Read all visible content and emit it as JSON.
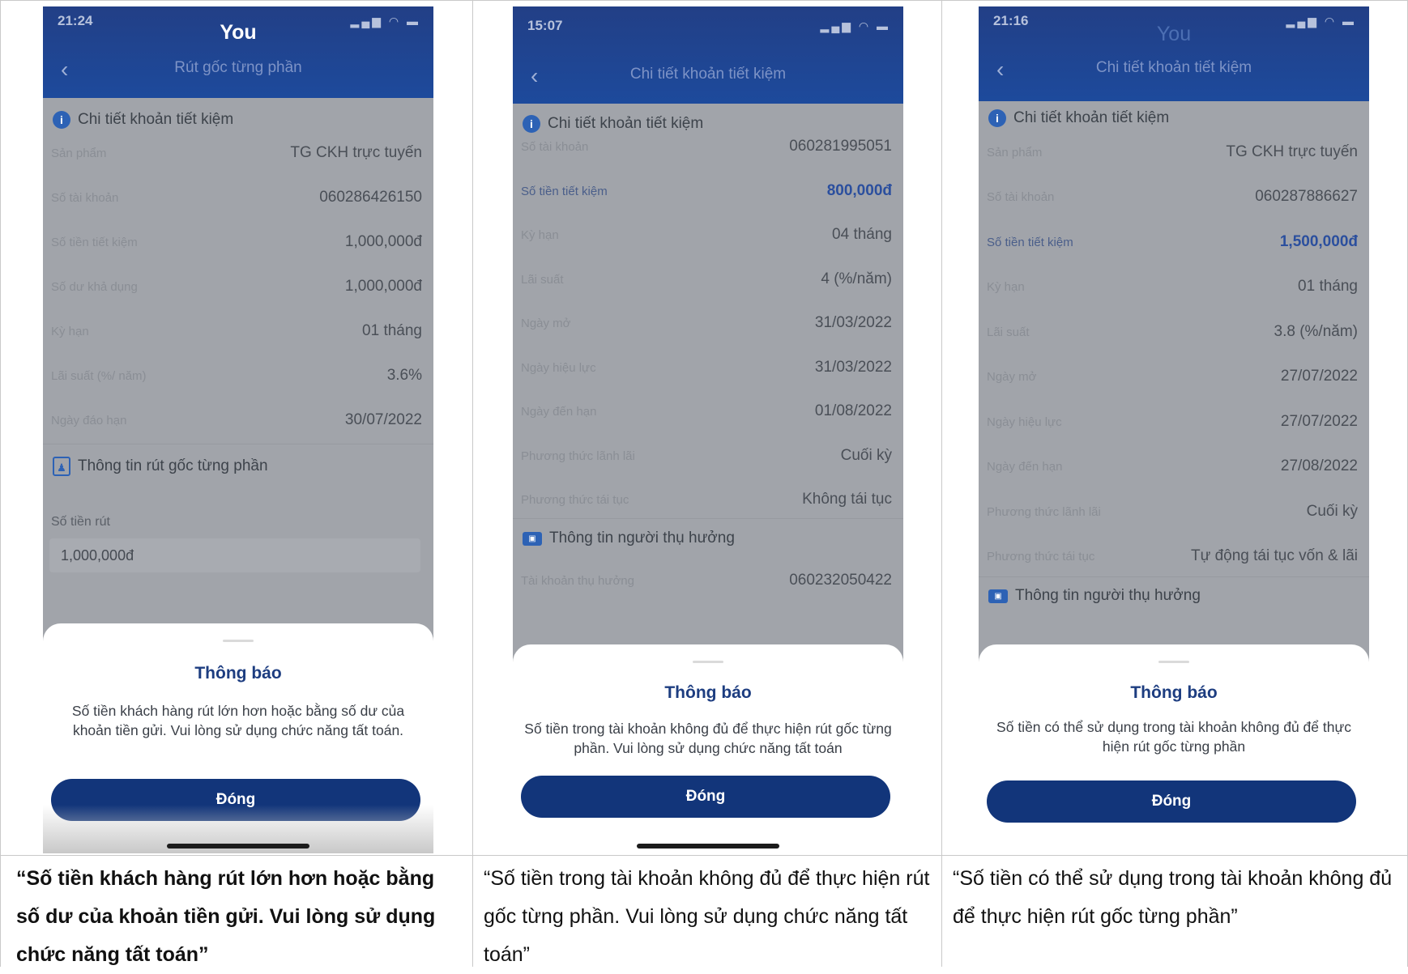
{
  "panels": [
    {
      "status_time": "21:24",
      "header_title": "You",
      "nav_title": "Rút gốc từng phần",
      "section_title": "Chi tiết khoản tiết kiệm",
      "rows": [
        {
          "label": "Sản phẩm",
          "value": "TG CKH trực tuyến"
        },
        {
          "label": "Số tài khoản",
          "value": "060286426150"
        },
        {
          "label": "Số tiền tiết kiệm",
          "value": "1,000,000đ"
        },
        {
          "label": "Số dư khả dụng",
          "value": "1,000,000đ"
        },
        {
          "label": "Kỳ hạn",
          "value": "01 tháng"
        },
        {
          "label": "Lãi suất (%/ năm)",
          "value": "3.6%"
        },
        {
          "label": "Ngày đáo hạn",
          "value": "30/07/2022"
        }
      ],
      "section2_title": "Thông tin rút gốc từng phần",
      "amount_label": "Số tiền rút",
      "amount_value": "1,000,000đ",
      "sheet": {
        "title": "Thông báo",
        "message": "Số tiền khách hàng rút lớn hơn hoặc bằng số dư của khoản tiền gửi. Vui lòng sử dụng chức năng tất toán.",
        "button": "Đóng"
      }
    },
    {
      "status_time": "15:07",
      "nav_title": "Chi tiết khoản tiết kiệm",
      "section_title": "Chi tiết khoản tiết kiệm",
      "rows": [
        {
          "label": "Số tài khoản",
          "value": "060281995051"
        },
        {
          "label": "Số tiền tiết kiệm",
          "value": "800,000đ"
        },
        {
          "label": "Kỳ hạn",
          "value": "04 tháng"
        },
        {
          "label": "Lãi suất",
          "value": "4 (%/năm)"
        },
        {
          "label": "Ngày mở",
          "value": "31/03/2022"
        },
        {
          "label": "Ngày hiệu lực",
          "value": "31/03/2022"
        },
        {
          "label": "Ngày đến hạn",
          "value": "01/08/2022"
        },
        {
          "label": "Phương thức lãnh lãi",
          "value": "Cuối kỳ"
        },
        {
          "label": "Phương thức tái tục",
          "value": "Không tái tục"
        }
      ],
      "section2_title": "Thông tin người thụ hưởng",
      "beneficiary_label": "Tài khoản thụ hưởng",
      "beneficiary_value": "060232050422",
      "sheet": {
        "title": "Thông báo",
        "message": "Số tiền trong tài khoản không đủ để thực hiện rút gốc từng phần. Vui lòng sử dụng chức năng tất toán",
        "button": "Đóng"
      }
    },
    {
      "status_time": "21:16",
      "header_title": "You",
      "nav_title": "Chi tiết khoản tiết kiệm",
      "section_title": "Chi tiết khoản tiết kiệm",
      "rows": [
        {
          "label": "Sản phẩm",
          "value": "TG CKH trực tuyến"
        },
        {
          "label": "Số tài khoản",
          "value": "060287886627"
        },
        {
          "label": "Số tiền tiết kiệm",
          "value": "1,500,000đ"
        },
        {
          "label": "Kỳ hạn",
          "value": "01 tháng"
        },
        {
          "label": "Lãi suất",
          "value": "3.8 (%/năm)"
        },
        {
          "label": "Ngày mở",
          "value": "27/07/2022"
        },
        {
          "label": "Ngày hiệu lực",
          "value": "27/07/2022"
        },
        {
          "label": "Ngày đến hạn",
          "value": "27/08/2022"
        },
        {
          "label": "Phương thức lãnh lãi",
          "value": "Cuối kỳ"
        },
        {
          "label": "Phương thức tái tục",
          "value": "Tự động tái tục vốn & lãi"
        }
      ],
      "section2_title": "Thông tin người thụ hưởng",
      "sheet": {
        "title": "Thông báo",
        "message": "Số tiền có thể sử dụng trong tài khoản không đủ để thực hiện rút gốc từng phần",
        "button": "Đóng"
      }
    }
  ],
  "captions": [
    "“Số tiền khách hàng rút lớn hơn hoặc bằng số dư của khoản tiền gửi. Vui lòng sử dụng chức năng tất toán”",
    "“Số tiền trong tài khoản không đủ để thực hiện rút gốc từng phần. Vui lòng sử dụng chức năng tất toán”",
    "“Số tiền có thể sử dụng trong tài khoản không đủ để thực hiện rút gốc từng phần”"
  ]
}
